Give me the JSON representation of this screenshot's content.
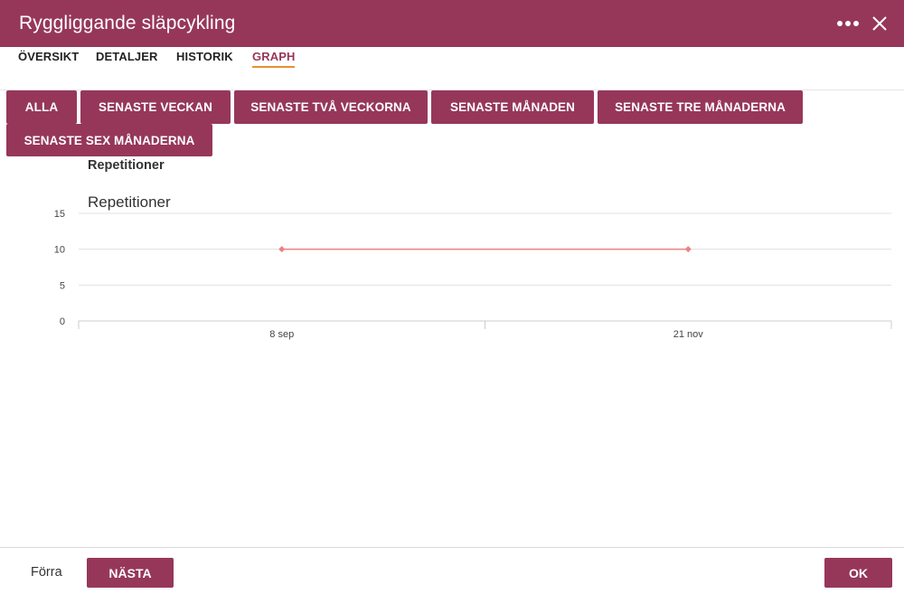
{
  "header": {
    "title": "Ryggliggande släpcykling",
    "more_icon": "more-horizontal-icon",
    "close_icon": "close-icon"
  },
  "tabs": [
    {
      "label": "ÖVERSIKT"
    },
    {
      "label": "DETALJER"
    },
    {
      "label": "HISTORIK"
    },
    {
      "label": "GRAPH",
      "active": true
    }
  ],
  "ranges": [
    {
      "label": "ALLA"
    },
    {
      "label": "SENASTE VECKAN"
    },
    {
      "label": "SENASTE TVÅ VECKORNA"
    },
    {
      "label": "SENASTE MÅNADEN"
    },
    {
      "label": "SENASTE TRE MÅNADERNA"
    },
    {
      "label": "SENASTE SEX MÅNADERNA"
    }
  ],
  "section_label": "Repetitioner",
  "chart_data": {
    "type": "line",
    "title": "Repetitioner",
    "x": [
      "8 sep",
      "21 nov"
    ],
    "series": [
      {
        "values": [
          10,
          10
        ],
        "color": "#f08080"
      }
    ],
    "ylim": [
      0,
      15
    ],
    "yticks": [
      0,
      5,
      10,
      15
    ],
    "grid": true
  },
  "footer": {
    "prev_label": "Förra",
    "next_label": "NÄSTA",
    "ok_label": "OK"
  },
  "colors": {
    "brand": "#96375a",
    "tab_underline": "#e8912d",
    "line": "#f08080"
  }
}
